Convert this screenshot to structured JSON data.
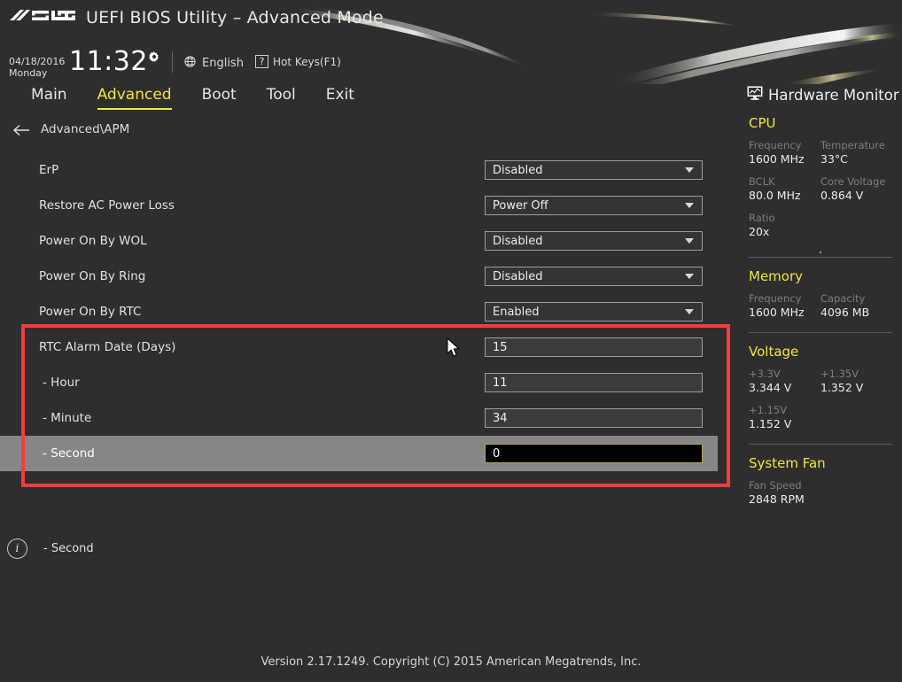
{
  "header": {
    "brand": "ASUS",
    "title": "UEFI BIOS Utility – Advanced Mode",
    "date": "04/18/2016",
    "weekday": "Monday",
    "time": "11:32",
    "gear_icon": "gear-icon",
    "language_icon": "globe-icon",
    "language": "English",
    "hotkeys_icon": "question-mark-icon",
    "hotkeys": "Hot Keys(F1)"
  },
  "tabs": [
    {
      "label": "Main",
      "active": false
    },
    {
      "label": "Advanced",
      "active": true
    },
    {
      "label": "Boot",
      "active": false
    },
    {
      "label": "Tool",
      "active": false
    },
    {
      "label": "Exit",
      "active": false
    }
  ],
  "breadcrumb": {
    "back_icon": "back-arrow-icon",
    "path": "Advanced\\APM"
  },
  "settings": [
    {
      "label": "ErP",
      "type": "dropdown",
      "value": "Disabled",
      "indent": false,
      "selected": false
    },
    {
      "label": "Restore AC Power Loss",
      "type": "dropdown",
      "value": "Power Off",
      "indent": false,
      "selected": false
    },
    {
      "label": "Power On By WOL",
      "type": "dropdown",
      "value": "Disabled",
      "indent": false,
      "selected": false
    },
    {
      "label": "Power On By Ring",
      "type": "dropdown",
      "value": "Disabled",
      "indent": false,
      "selected": false
    },
    {
      "label": "Power On By RTC",
      "type": "dropdown",
      "value": "Enabled",
      "indent": false,
      "selected": false
    },
    {
      "label": "RTC Alarm Date (Days)",
      "type": "field",
      "value": "15",
      "indent": false,
      "selected": false
    },
    {
      "label": "- Hour",
      "type": "field",
      "value": "11",
      "indent": true,
      "selected": false
    },
    {
      "label": "- Minute",
      "type": "field",
      "value": "34",
      "indent": true,
      "selected": false
    },
    {
      "label": "- Second",
      "type": "field",
      "value": "0",
      "indent": true,
      "selected": true
    }
  ],
  "help": {
    "info_icon": "info-icon",
    "text": "- Second"
  },
  "footer": {
    "version": "Version 2.17.1249. Copyright (C) 2015 American Megatrends, Inc."
  },
  "hardware_monitor": {
    "icon": "monitor-chart-icon",
    "title": "Hardware Monitor",
    "groups": [
      {
        "title": "CPU",
        "entries": [
          {
            "key": "Frequency",
            "value": "1600 MHz"
          },
          {
            "key": "Temperature",
            "value": "33°C"
          },
          {
            "key": "BCLK",
            "value": "80.0 MHz"
          },
          {
            "key": "Core Voltage",
            "value": "0.864 V"
          },
          {
            "key": "Ratio",
            "value": "20x"
          }
        ]
      },
      {
        "title": "Memory",
        "entries": [
          {
            "key": "Frequency",
            "value": "1600 MHz"
          },
          {
            "key": "Capacity",
            "value": "4096 MB"
          }
        ]
      },
      {
        "title": "Voltage",
        "entries": [
          {
            "key": "+3.3V",
            "value": "3.344 V"
          },
          {
            "key": "+1.35V",
            "value": "1.352 V"
          },
          {
            "key": "+1.15V",
            "value": "1.152 V"
          }
        ]
      },
      {
        "title": "System Fan",
        "entries": [
          {
            "key": "Fan Speed",
            "value": "2848 RPM"
          }
        ]
      }
    ]
  },
  "colors": {
    "background": "#2e2e2e",
    "accent_yellow": "#f2e33c",
    "annotation_red": "#f93b3b",
    "selected_row": "#868686",
    "active_field_border": "#b0a44e"
  }
}
